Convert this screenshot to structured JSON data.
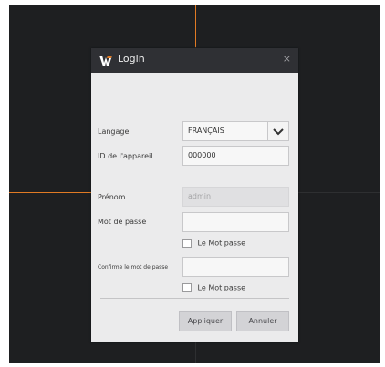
{
  "dialog": {
    "title": "Login",
    "close_glyph": "×",
    "logo_icon": "brand-w-logo-icon"
  },
  "form": {
    "language_label": "Langage",
    "language_value": "FRANÇAIS",
    "device_id_label": "ID de l'appareil",
    "device_id_value": "000000",
    "first_name_label": "Prénom",
    "first_name_value": "admin",
    "password_label": "Mot de passe",
    "password_value": "",
    "show_password_label": "Le Mot passe",
    "confirm_password_label": "Confirme le mot de passe",
    "confirm_password_value": "",
    "show_confirm_label": "Le Mot passe"
  },
  "buttons": {
    "apply": "Appliquer",
    "cancel": "Annuler"
  },
  "colors": {
    "accent_line": "#e07a24",
    "titlebar": "#2f3034"
  }
}
